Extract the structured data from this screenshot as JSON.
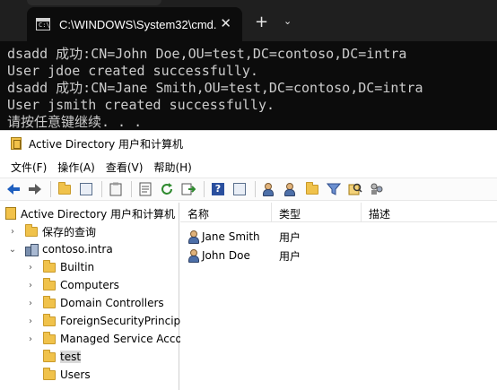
{
  "terminal": {
    "tab_title": "C:\\WINDOWS\\System32\\cmd.",
    "tab_icon_text": "C:\\",
    "close_glyph": "✕",
    "new_tab_glyph": "+",
    "dropdown_glyph": "⌄",
    "lines": [
      "dsadd 成功:CN=John Doe,OU=test,DC=contoso,DC=intra",
      "User jdoe created successfully.",
      "dsadd 成功:CN=Jane Smith,OU=test,DC=contoso,DC=intra",
      "User jsmith created successfully.",
      "请按任意键继续. . ."
    ]
  },
  "ad": {
    "title": "Active Directory 用户和计算机",
    "menu": [
      "文件(F)",
      "操作(A)",
      "查看(V)",
      "帮助(H)"
    ],
    "tree": {
      "root": "Active Directory 用户和计算机",
      "saved_queries": "保存的查询",
      "domain": "contoso.intra",
      "children": [
        "Builtin",
        "Computers",
        "Domain Controllers",
        "ForeignSecurityPrincipa",
        "Managed Service Acco",
        "test",
        "Users"
      ],
      "selected": "test"
    },
    "list": {
      "columns": [
        "名称",
        "类型",
        "描述"
      ],
      "rows": [
        {
          "name": "Jane Smith",
          "type": "用户",
          "description": ""
        },
        {
          "name": "John Doe",
          "type": "用户",
          "description": ""
        }
      ]
    },
    "colors": {
      "toolbar_arrow": "#1f5fbf",
      "folder": "#f0c24b",
      "selection": "#d9d9d9"
    }
  }
}
